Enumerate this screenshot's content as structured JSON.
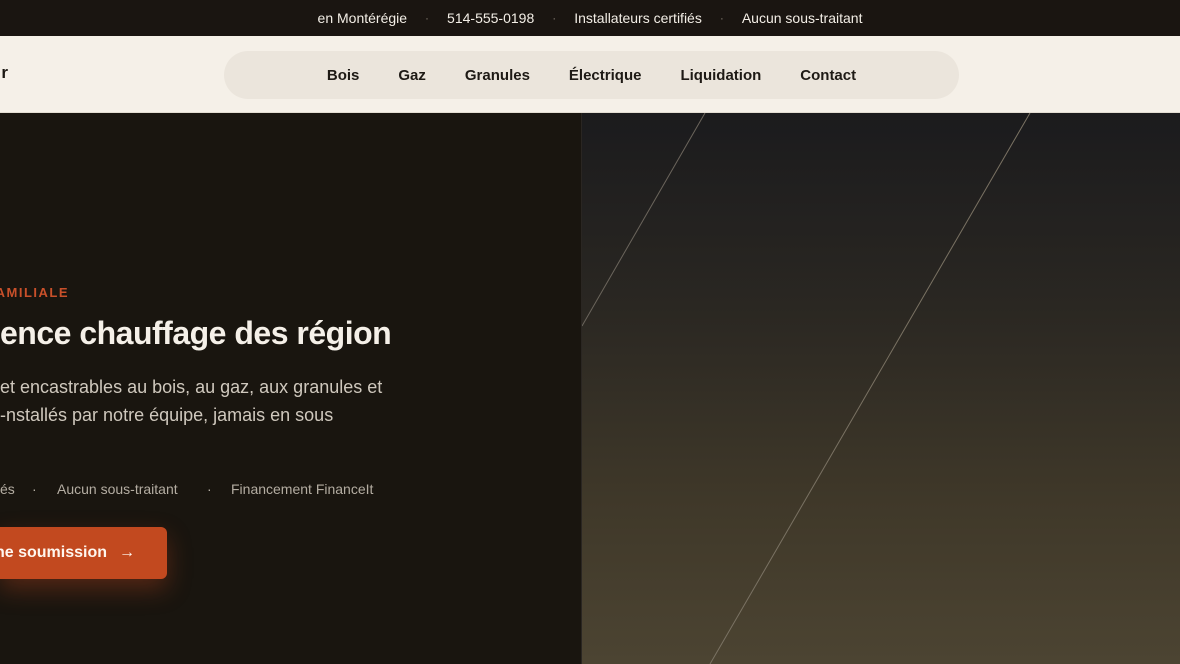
{
  "topbar": {
    "items": [
      "en Montérégie",
      "514-555-0198",
      "Installateurs certifiés",
      "Aucun sous-traitant"
    ]
  },
  "header": {
    "brand_fragment": "r",
    "nav": [
      "Bois",
      "Gaz",
      "Granules",
      "Électrique",
      "Liquidation",
      "Contact"
    ]
  },
  "hero": {
    "eyebrow": "AMILIALE",
    "title": "ence chauffage des région",
    "description_lines": [
      "et encastrables au bois, au gaz, aux granules et",
      "nstallés par notre équipe, jamais en sous-"
    ],
    "badges": [
      "és",
      "Aucun sous-traitant",
      "Financement FinanceIt"
    ],
    "badge_separator": "·",
    "cta_label": "ne soumission",
    "cta_icon": "arrow-right-icon"
  },
  "colors": {
    "accent": "#c2491f",
    "eyebrow": "#c9502a",
    "dark_bg": "#19150f",
    "header_bg": "#f5f0e8",
    "nav_pill": "#ebe5dc"
  }
}
